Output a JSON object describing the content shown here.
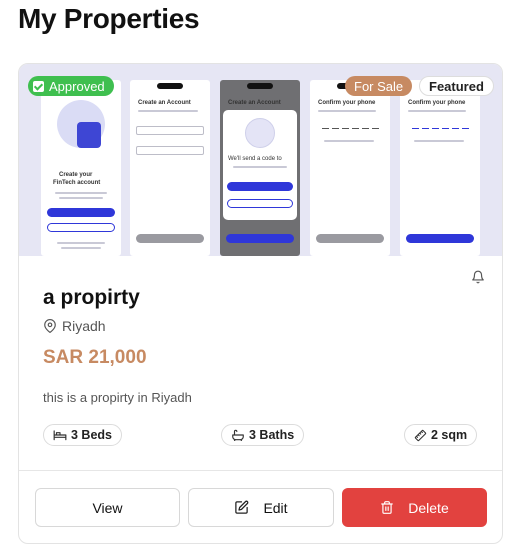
{
  "page": {
    "title": "My Properties"
  },
  "property": {
    "badges": {
      "approved": "Approved",
      "for_sale": "For Sale",
      "featured": "Featured"
    },
    "title": "a propirty",
    "location": "Riyadh",
    "price": "SAR 21,000",
    "description": "this is a propirty in Riyadh",
    "features": {
      "beds": "3 Beds",
      "baths": "3 Baths",
      "area": "2 sqm"
    },
    "actions": {
      "view": "View",
      "edit": "Edit",
      "delete": "Delete"
    },
    "image_texts": {
      "s1_title": "Create your",
      "s1_title2": "FinTech account",
      "s2_title": "Create an Account",
      "s3_title": "Create an Account",
      "s3_modal": "We'll send a code to",
      "s4_title": "Confirm your phone",
      "s5_title": "Confirm your phone"
    }
  },
  "colors": {
    "approved": "#3fbf4f",
    "sale_badge": "#c78a62",
    "price": "#c78a62",
    "delete": "#e2423f",
    "screens_primary": "#2f37d9"
  },
  "icons": {
    "approved": "check-box-icon",
    "bell": "bell-icon",
    "location": "map-pin-icon",
    "beds": "bed-icon",
    "baths": "bath-icon",
    "area": "ruler-icon",
    "edit": "pencil-square-icon",
    "delete": "trash-icon"
  }
}
